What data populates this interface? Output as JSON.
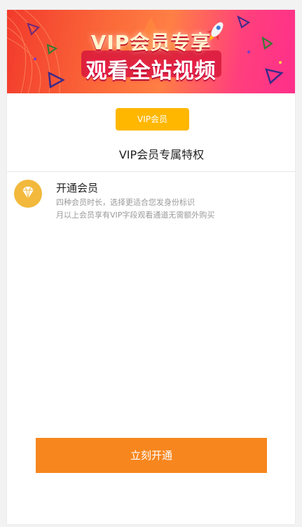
{
  "banner": {
    "line1": "VIP会员专享",
    "line2": "观看全站视频"
  },
  "membership": {
    "badge": "VIP会员",
    "title": "VIP会员专属特权"
  },
  "benefit": {
    "icon": "diamond-icon",
    "title": "开通会员",
    "desc_line1": "四种会员时长，选择更适合您发身份标识",
    "desc_line2": "月以上会员享有VIP字段观看通道无需额外购买"
  },
  "action": {
    "button_label": "立刻开通"
  },
  "colors": {
    "badge": "#ffb700",
    "button": "#f7861e",
    "icon_bg": "#f2b93c"
  }
}
